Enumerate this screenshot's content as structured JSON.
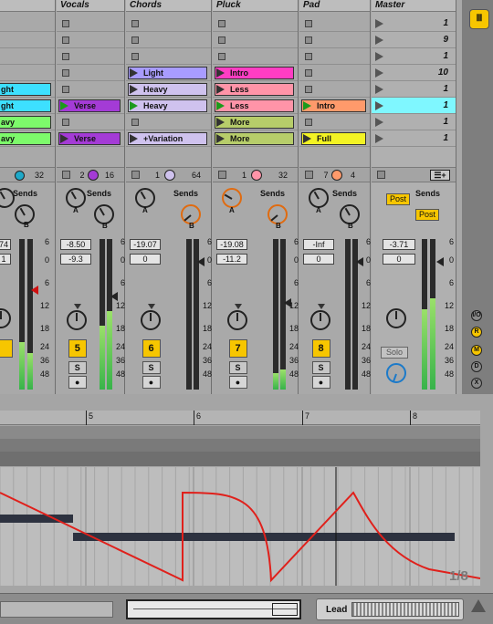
{
  "tracks": [
    {
      "title": "",
      "slots": [
        {
          "label": "",
          "color": ""
        },
        {
          "label": "",
          "color": ""
        },
        {
          "label": "",
          "color": ""
        },
        {
          "label": "",
          "color": ""
        },
        {
          "label": "ght",
          "color": "#3de0ff"
        },
        {
          "label": "ght",
          "color": "#3de0ff"
        },
        {
          "label": "avy",
          "color": "#7dfa6b"
        },
        {
          "label": "avy",
          "color": "#7dfa6b"
        }
      ],
      "io_left": "",
      "io_right": "32",
      "vol": "74",
      "pan": "1",
      "number": ""
    },
    {
      "title": "Vocals",
      "slots": [
        {
          "label": "",
          "color": ""
        },
        {
          "label": "",
          "color": ""
        },
        {
          "label": "",
          "color": ""
        },
        {
          "label": "",
          "color": ""
        },
        {
          "label": "",
          "color": ""
        },
        {
          "label": "Verse",
          "color": "#a43bd6",
          "playing": true
        },
        {
          "label": "",
          "color": ""
        },
        {
          "label": "Verse",
          "color": "#a43bd6"
        }
      ],
      "io_left": "2",
      "io_right": "16",
      "vol": "-8.50",
      "pan": "-9.3",
      "number": "5"
    },
    {
      "title": "Chords",
      "slots": [
        {
          "label": "",
          "color": ""
        },
        {
          "label": "",
          "color": ""
        },
        {
          "label": "",
          "color": ""
        },
        {
          "label": "Light",
          "color": "#a89cff"
        },
        {
          "label": "Heavy",
          "color": "#cfc2ee"
        },
        {
          "label": "Heavy",
          "color": "#cfc2ee",
          "playing": true
        },
        {
          "label": "",
          "color": ""
        },
        {
          "label": "+Variation",
          "color": "#cfc2ee"
        }
      ],
      "io_left": "1",
      "io_right": "64",
      "vol": "-19.07",
      "pan": "0",
      "number": "6"
    },
    {
      "title": "Pluck",
      "slots": [
        {
          "label": "",
          "color": ""
        },
        {
          "label": "",
          "color": ""
        },
        {
          "label": "",
          "color": ""
        },
        {
          "label": "Intro",
          "color": "#ff3dc3"
        },
        {
          "label": "Less",
          "color": "#ff94a8"
        },
        {
          "label": "Less",
          "color": "#ff94a8",
          "playing": true
        },
        {
          "label": "More",
          "color": "#b7cd6a"
        },
        {
          "label": "More",
          "color": "#b7cd6a"
        }
      ],
      "io_left": "1",
      "io_right": "32",
      "vol": "-19.08",
      "pan": "-11.2",
      "number": "7"
    },
    {
      "title": "Pad",
      "slots": [
        {
          "label": "",
          "color": ""
        },
        {
          "label": "",
          "color": ""
        },
        {
          "label": "",
          "color": ""
        },
        {
          "label": "",
          "color": ""
        },
        {
          "label": "",
          "color": ""
        },
        {
          "label": "Intro",
          "color": "#ff9a6b",
          "playing": true
        },
        {
          "label": "",
          "color": ""
        },
        {
          "label": "Full",
          "color": "#f3f324"
        }
      ],
      "io_left": "7",
      "io_right": "4",
      "vol": "-Inf",
      "pan": "0",
      "number": "8"
    }
  ],
  "master": {
    "title": "Master",
    "scenes": [
      "1",
      "9",
      "1",
      "10",
      "1",
      "1",
      "1",
      "1"
    ],
    "selected_scene": 5,
    "vol": "-3.71",
    "pan": "0",
    "post_a": "Post",
    "post_b": "Post",
    "sends_label": "Sends",
    "solo_label": "Solo"
  },
  "labels": {
    "sends": "Sends",
    "knob_a": "A",
    "knob_b": "B",
    "solo_btn": "S"
  },
  "meter_scale": [
    "6",
    "0",
    "6",
    "12",
    "18",
    "24",
    "36",
    "48"
  ],
  "master_meter_scale": [
    "6",
    "0",
    "6",
    "12",
    "18",
    "24",
    "36",
    "48"
  ],
  "side_buttons": [
    "I/O",
    "S",
    "R",
    "M",
    "D",
    "X"
  ],
  "ruler": {
    "marks": [
      "5",
      "6",
      "7",
      "8"
    ]
  },
  "detail": {
    "page_indicator": "1/8"
  },
  "status": {
    "track_label": "Lead"
  },
  "colors": {
    "selected_scene": "#7ff7ff",
    "envelope": "#e0201b",
    "number_badge": "#f7c600"
  }
}
